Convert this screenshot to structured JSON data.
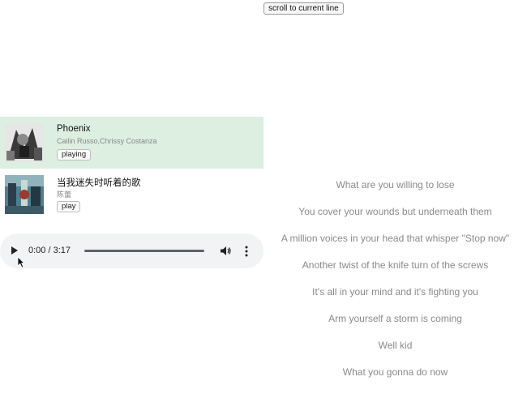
{
  "toolbar": {
    "scroll_label": "scroll to current line"
  },
  "playlist": {
    "songs": [
      {
        "title": "Phoenix",
        "artist": "Cailin Russo,Chrissy Costanza",
        "button": "playing",
        "active": true
      },
      {
        "title": "当我迷失时听着的歌",
        "artist": "陈蕾",
        "button": "play",
        "active": false
      }
    ]
  },
  "player": {
    "time": "0:00 / 3:17",
    "progress": 0,
    "icons": [
      "play-icon",
      "volume-icon",
      "more-options-icon"
    ]
  },
  "lyrics": [
    "What are you willing to lose",
    "You cover your wounds but underneath them",
    "A million voices in your head that whisper \"Stop now\"",
    "Another twist of the knife turn of the screws",
    "It's all in your mind and it's fighting you",
    "Arm yourself a storm is coming",
    "Well kid",
    "What you gonna do now"
  ],
  "colors": {
    "active_row": "#dcefe1",
    "player_bg": "#f1f3f4",
    "lyric_text": "#8a8a8a"
  }
}
